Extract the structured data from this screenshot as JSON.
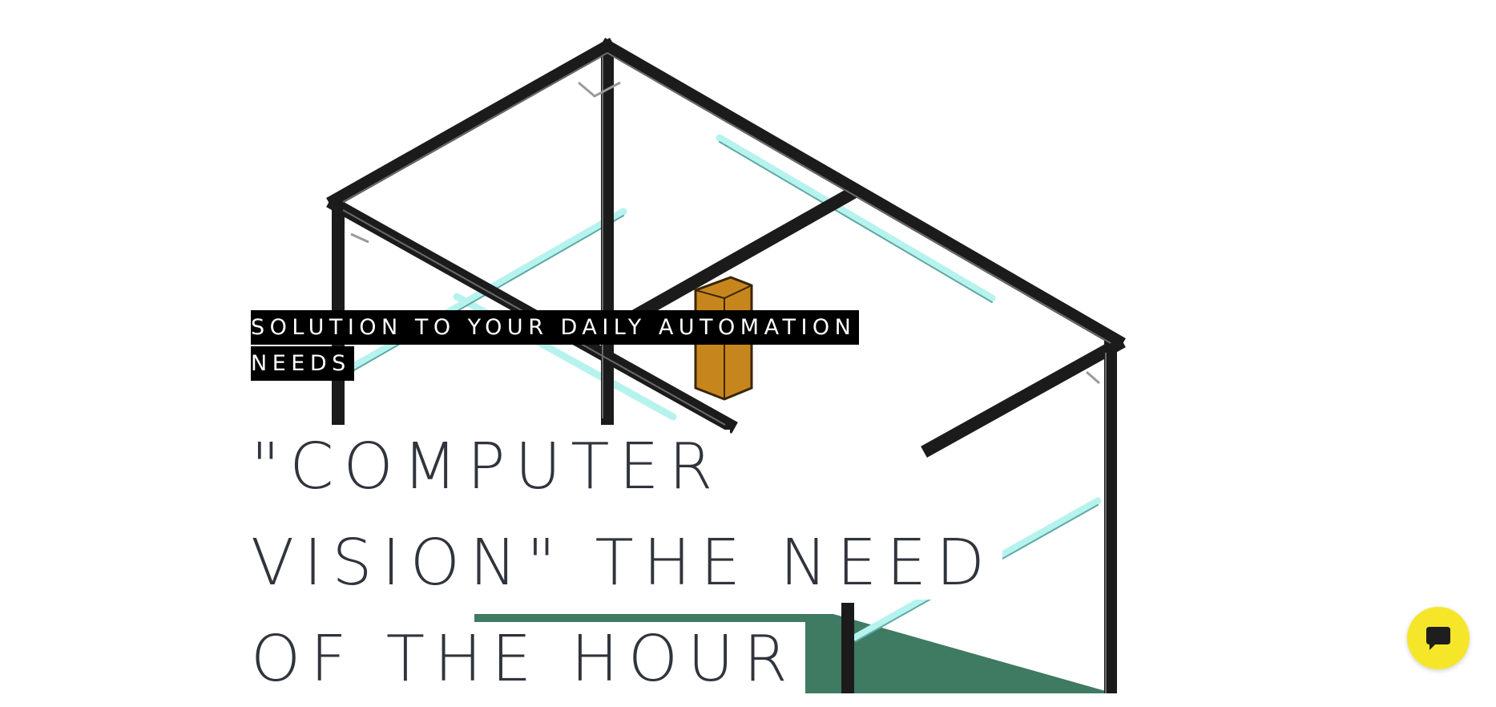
{
  "hero": {
    "tagline": "SOLUTION TO YOUR DAILY AUTOMATION NEEDS",
    "headline": "\"COMPUTER VISION\" THE NEED OF THE HOUR"
  },
  "hero_image": {
    "subject": "3D render of aluminium extrusion frame with camera box",
    "colors": {
      "frame": "#1b1b1b",
      "rail": "#b7f3ee",
      "camera_box": "#c7861d",
      "base_plate": "#3f7a63"
    }
  },
  "chat_widget": {
    "icon": "chat-bubble-icon",
    "color": "#f6e62a"
  },
  "colors": {
    "headline": "#30343c",
    "tagline_bg": "#000000",
    "tagline_text": "#ffffff"
  }
}
